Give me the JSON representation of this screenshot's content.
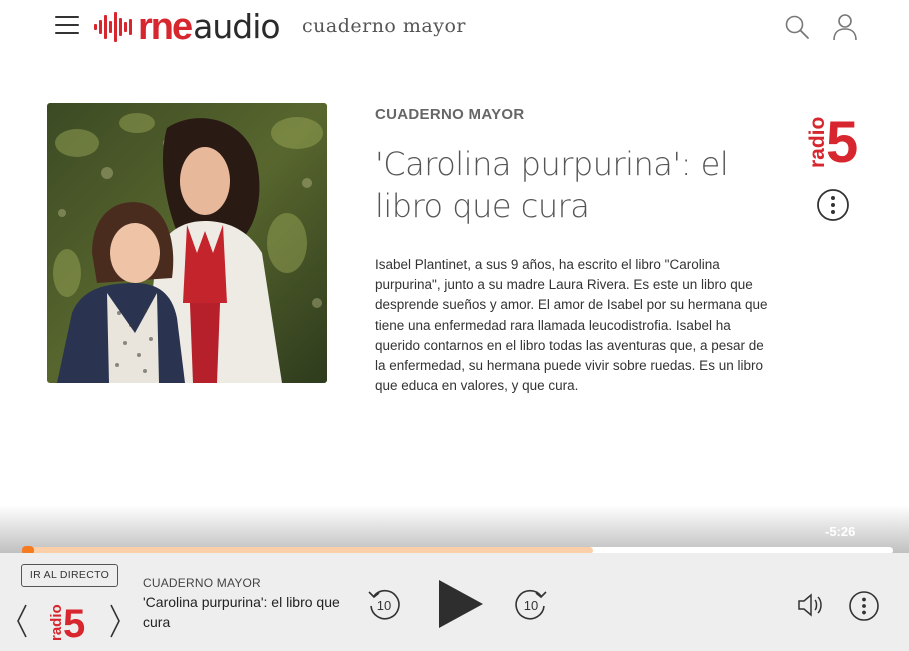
{
  "header": {
    "logo_rne": "rne",
    "logo_audio": "audio",
    "section_name": "cuaderno mayor",
    "menu_icon": "hamburger-menu-icon",
    "search_icon": "search-icon",
    "user_icon": "user-icon"
  },
  "episode": {
    "program": "CUADERNO MAYOR",
    "title": "'Carolina purpurina': el libro que cura",
    "description": "Isabel Plantinet, a sus 9 años, ha escrito el libro \"Carolina purpurina\", junto a su madre Laura Rivera. Es este un libro que desprende sueños y amor. El amor de Isabel por su hermana que tiene una enfermedad rara llamada leucodistrofia. Isabel ha querido contarnos en el libro todas las aventuras que, a pesar de la enfermedad, su hermana puede vivir sobre ruedas. Es un libro que educa en valores, y que cura.",
    "station_logo_word": "radio",
    "station_logo_number": "5"
  },
  "player": {
    "remaining_time": "-5:26",
    "progress_fraction": 0.007,
    "buffered_fraction": 0.656,
    "live_button": "IR AL DIRECTO",
    "station_word": "radio",
    "station_number": "5",
    "now_playing_program": "CUADERNO MAYOR",
    "now_playing_title": "'Carolina purpurina': el libro que cura",
    "rewind_seconds": "10",
    "forward_seconds": "10"
  },
  "colors": {
    "brand_red": "#d8262e",
    "progress_orange": "#f47b20",
    "buffer_peach": "#fbd0a8",
    "player_bg": "#eeeeee"
  }
}
